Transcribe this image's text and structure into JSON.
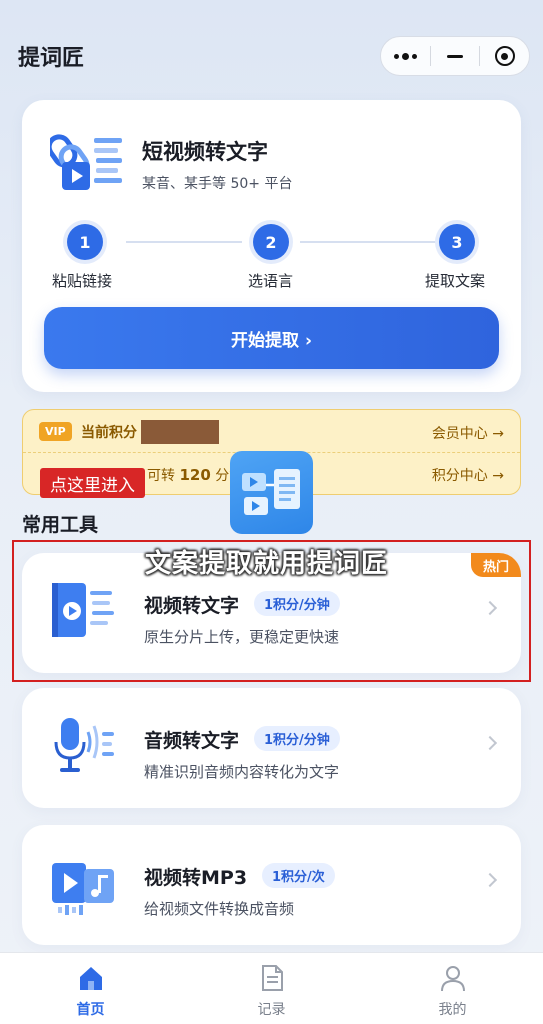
{
  "app": {
    "title": "提词匠"
  },
  "hero": {
    "title": "短视频转文字",
    "subtitle": "某音、某手等 50+ 平台",
    "steps": [
      {
        "num": "1",
        "label": "粘贴链接"
      },
      {
        "num": "2",
        "label": "选语言"
      },
      {
        "num": "3",
        "label": "提取文案"
      }
    ],
    "start_button": "开始提取 ›"
  },
  "vip": {
    "badge": "VIP",
    "points_label": "当前积分",
    "member_center": "会员中心 →",
    "convert_prefix": "可转",
    "convert_value": "120",
    "convert_suffix": "分钟视频",
    "points_center": "积分中心 →"
  },
  "overlay": {
    "tag": "点这里进入",
    "caption": "文案提取就用提词匠"
  },
  "section": {
    "title": "常用工具"
  },
  "tools": [
    {
      "title": "视频转文字",
      "price": "1积分/分钟",
      "desc": "原生分片上传，更稳定更快速",
      "badge": "热门"
    },
    {
      "title": "音频转文字",
      "price": "1积分/分钟",
      "desc": "精准识别音频内容转化为文字"
    },
    {
      "title": "视频转MP3",
      "price": "1积分/次",
      "desc": "给视频文件转换成音频"
    }
  ],
  "nav": [
    {
      "label": "首页",
      "icon": "home-icon",
      "active": true
    },
    {
      "label": "记录",
      "icon": "document-icon",
      "active": false
    },
    {
      "label": "我的",
      "icon": "user-icon",
      "active": false
    }
  ],
  "colors": {
    "primary": "#2e6be6",
    "vip_bg": "#fdf1c7",
    "hot": "#f28a1c",
    "highlight_frame": "#d32020"
  }
}
